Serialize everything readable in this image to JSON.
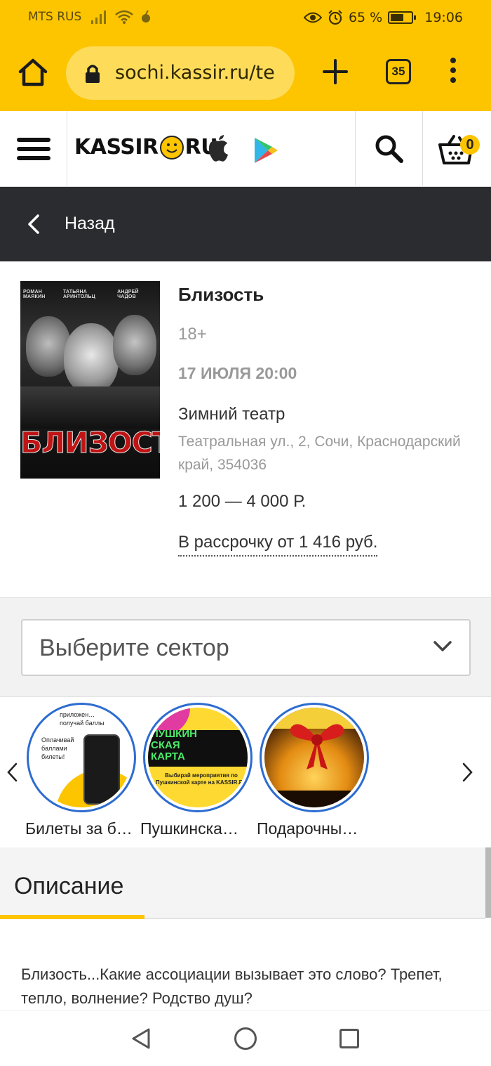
{
  "status_bar": {
    "carrier": "MTS RUS",
    "battery": "65 %",
    "battery_level": 0.65,
    "time": "19:06"
  },
  "browser": {
    "url": "sochi.kassir.ru/te",
    "tabs_count": "35"
  },
  "site_header": {
    "logo_left": "KASSIR",
    "logo_right": "RU",
    "cart_count": "0"
  },
  "back_bar": {
    "label": "Назад"
  },
  "poster": {
    "names": [
      "РОМАН МАЯКИН",
      "ТАТЬЯНА АРИНТОЛЬЦ",
      "АНДРЕЙ ЧАДОВ"
    ],
    "title": "БЛИЗОСТЬ"
  },
  "event": {
    "title": "Близость",
    "age": "18+",
    "date": "17 ИЮЛЯ 20:00",
    "venue": "Зимний театр",
    "address": "Театральная ул., 2, Сочи, Краснодарский край, 354036",
    "price": "1 200 — 4 000 Р.",
    "installment": "В рассрочку от 1 416 руб."
  },
  "sector_select": {
    "placeholder": "Выберите сектор"
  },
  "stories": [
    {
      "label": "Билеты за б…",
      "text_top": "приложен…\nполучай баллы",
      "text_mid": "Оплачивай\nбаллами\nбилеты!"
    },
    {
      "label": "Пушкинска…",
      "text_top": "ПУШКИН\nСКАЯ\nКАРТА",
      "text_mid": "Выбирай мероприятия по\nПушкинской карте на KASSIR.RU"
    },
    {
      "label": "Подарочны…"
    }
  ],
  "description": {
    "tab_label": "Описание",
    "text": "Близость...Какие ассоциации вызывает это слово? Трепет, тепло, волнение? Родство душ?"
  },
  "colors": {
    "brand_yellow": "#fdc400",
    "dark_bar": "#2b2c30",
    "story_ring": "#2d6cd0",
    "poster_title": "#c01414"
  }
}
